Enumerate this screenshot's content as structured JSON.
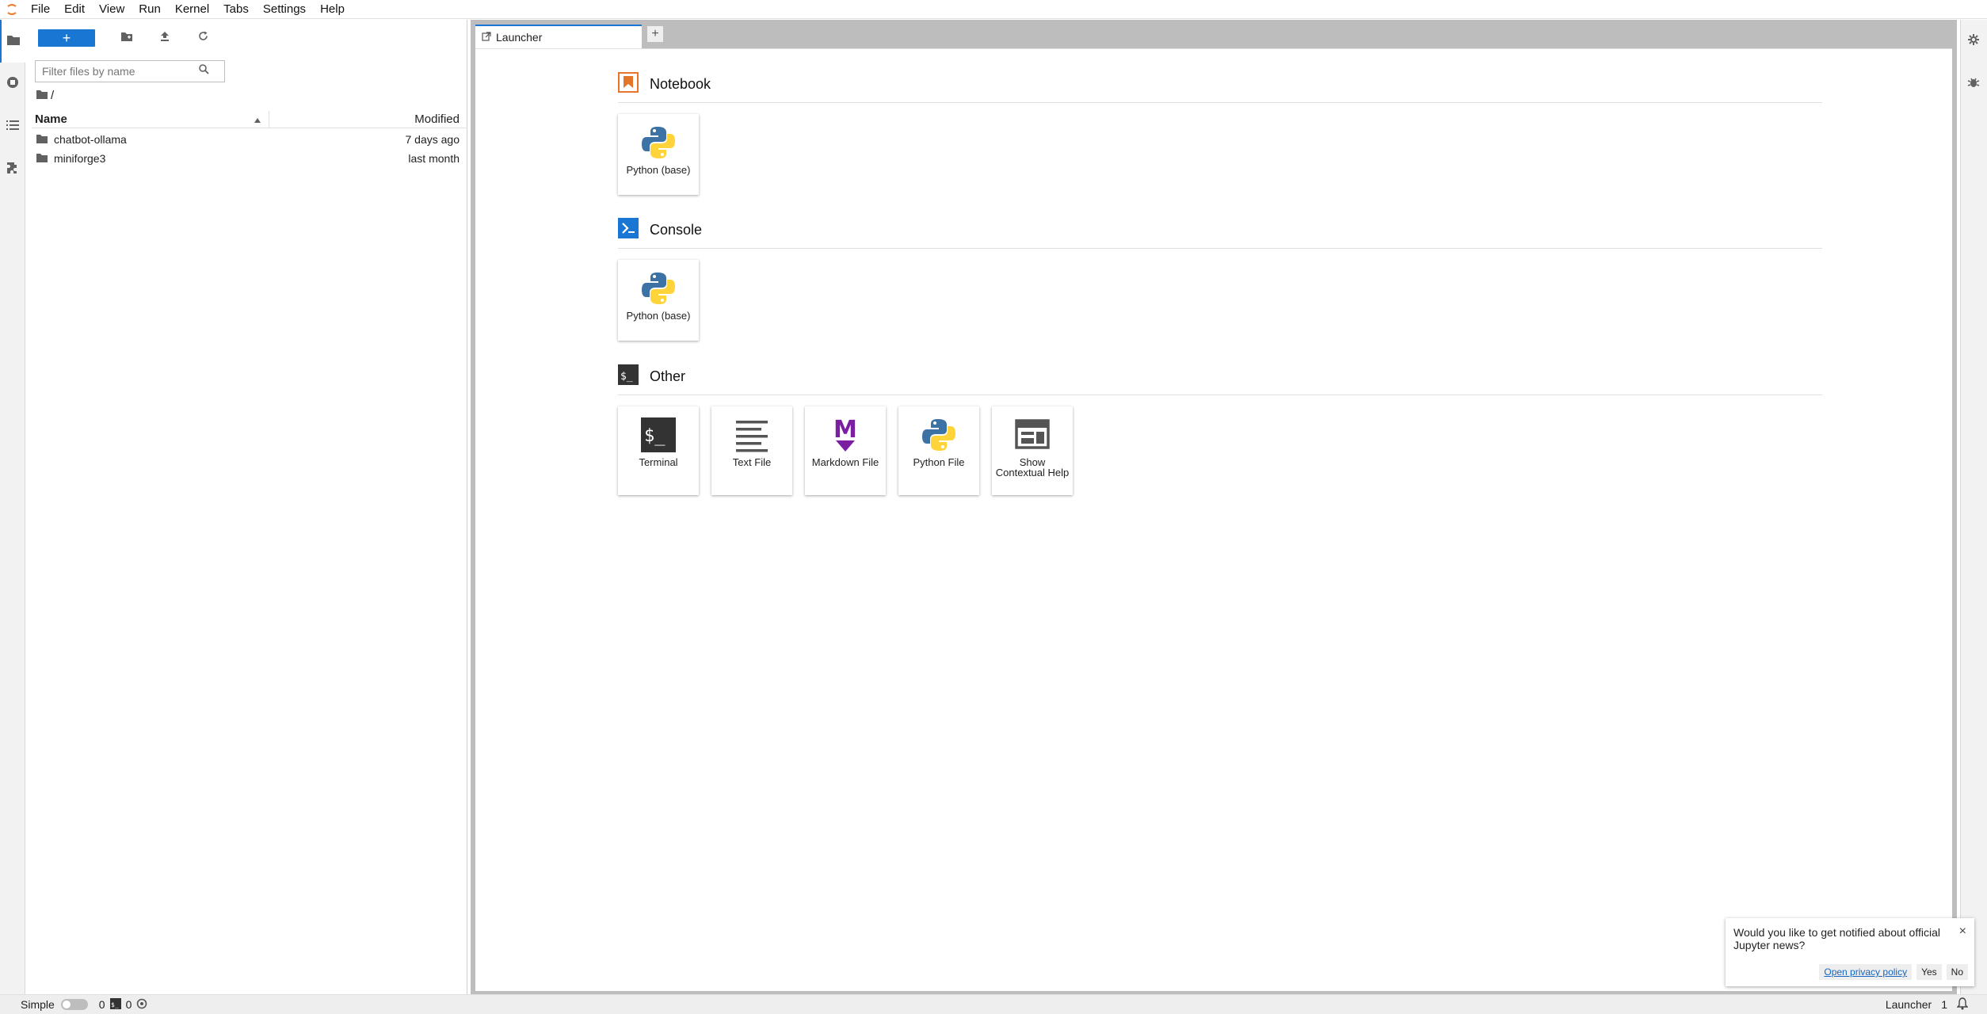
{
  "menu": {
    "items": [
      "File",
      "Edit",
      "View",
      "Run",
      "Kernel",
      "Tabs",
      "Settings",
      "Help"
    ]
  },
  "left_activity": {
    "icons": [
      "folder-icon",
      "running-icon",
      "toc-icon",
      "extension-icon"
    ]
  },
  "file_browser": {
    "new_button_label": "+",
    "filter_placeholder": "Filter files by name",
    "breadcrumb": "/",
    "columns": {
      "name": "Name",
      "modified": "Modified"
    },
    "rows": [
      {
        "name": "chatbot-ollama",
        "modified": "7 days ago"
      },
      {
        "name": "miniforge3",
        "modified": "last month"
      }
    ]
  },
  "tabs": {
    "items": [
      {
        "label": "Launcher"
      }
    ],
    "add_label": "+"
  },
  "launcher": {
    "sections": [
      {
        "title": "Notebook",
        "cards": [
          {
            "label": "Python (base)",
            "icon": "python-icon"
          }
        ]
      },
      {
        "title": "Console",
        "cards": [
          {
            "label": "Python (base)",
            "icon": "python-icon"
          }
        ]
      },
      {
        "title": "Other",
        "cards": [
          {
            "label": "Terminal",
            "icon": "terminal-icon"
          },
          {
            "label": "Text File",
            "icon": "text-file-icon"
          },
          {
            "label": "Markdown File",
            "icon": "markdown-icon"
          },
          {
            "label": "Python File",
            "icon": "python-icon"
          },
          {
            "label": "Show Contextual Help",
            "icon": "contextual-help-icon"
          }
        ]
      }
    ]
  },
  "statusbar": {
    "mode_label": "Simple",
    "kernels_count": "0",
    "terminals_count": "0",
    "active_tab": "Launcher",
    "notifications_count": "1"
  },
  "toast": {
    "message": "Would you like to get notified about official Jupyter news?",
    "privacy_label": "Open privacy policy",
    "yes_label": "Yes",
    "no_label": "No",
    "close_label": "×"
  },
  "colors": {
    "accent": "#1976d2",
    "notebook_icon": "#e4762b",
    "markdown_icon": "#7b1fa2",
    "python_blue": "#3d72a4",
    "python_yellow": "#ffd43b"
  }
}
